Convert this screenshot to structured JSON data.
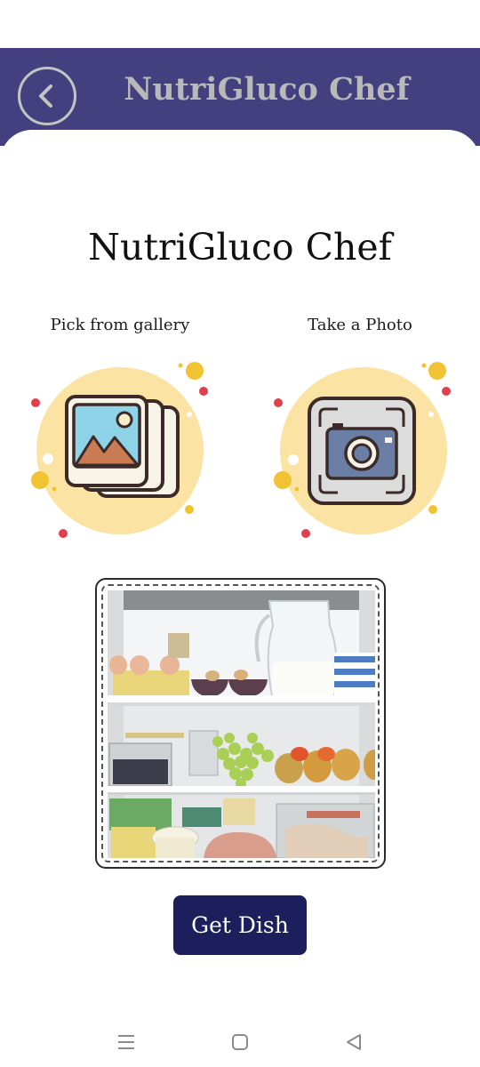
{
  "app_bar": {
    "title": "NutriGluco Chef",
    "back_icon": "chevron-left-icon",
    "background_color": "#443f7e"
  },
  "main": {
    "title": "NutriGluco Chef",
    "options": [
      {
        "label": "Pick from gallery",
        "icon": "gallery-stack-icon"
      },
      {
        "label": "Take a Photo",
        "icon": "camera-icon"
      }
    ],
    "preview_image": "fridge-contents-photo"
  },
  "actions": {
    "get_dish_label": "Get Dish",
    "button_color": "#1c1f5c"
  },
  "system_nav": {
    "icons": [
      "menu-icon",
      "home-icon",
      "back-triangle-icon"
    ]
  }
}
